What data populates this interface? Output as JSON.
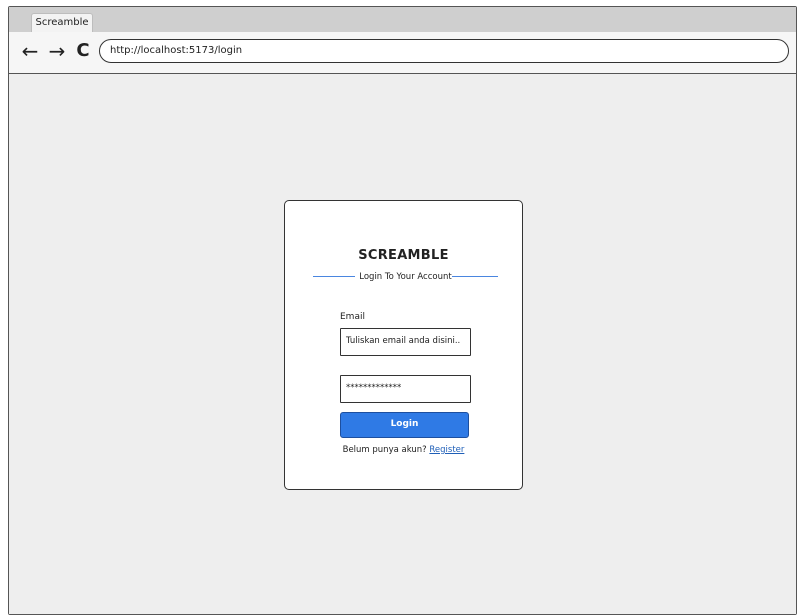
{
  "browser": {
    "tab_title": "Screamble",
    "url": "http://localhost:5173/login",
    "back_icon": "back-arrow-icon",
    "forward_icon": "forward-arrow-icon",
    "reload_icon": "reload-icon"
  },
  "login": {
    "brand": "SCREAMBLE",
    "subtitle": "Login To Your Account",
    "email_label": "Email",
    "email_value": "Tuliskan email anda disini..",
    "password_value": "*************",
    "login_button": "Login",
    "register_prompt": "Belum punya akun?",
    "register_link": "Register"
  },
  "colors": {
    "accent": "#2f7ae5",
    "divider": "#4a86e0",
    "link": "#1f5fb8",
    "page_background": "#eeeeee"
  }
}
